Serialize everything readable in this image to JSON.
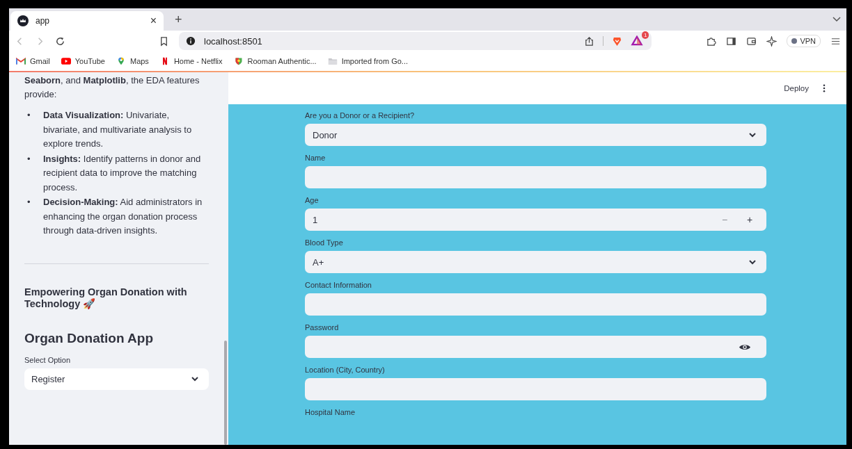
{
  "browser": {
    "tab": {
      "title": "app",
      "close": "×"
    },
    "new_tab": "+",
    "url": "localhost:8501",
    "badge": "1",
    "vpn": "VPN",
    "bookmarks": [
      {
        "label": "Gmail",
        "kind": "mail"
      },
      {
        "label": "YouTube",
        "kind": "video"
      },
      {
        "label": "Maps",
        "kind": "pin"
      },
      {
        "label": "Home - Netflix",
        "kind": "letter"
      },
      {
        "label": "Rooman Authentic...",
        "kind": "shield"
      },
      {
        "label": "Imported from Go...",
        "kind": "folder"
      }
    ]
  },
  "sidebar": {
    "intro": "**Seaborn**, and **Matplotlib**, the EDA features provide:",
    "bullets": [
      {
        "marker": "•",
        "text": "**Data Visualization:** Univariate, bivariate, and multivariate analysis to explore trends."
      },
      {
        "marker": "•",
        "text": "**Insights:** Identify patterns in donor and recipient data to improve the matching process."
      },
      {
        "marker": "•",
        "text": "**Decision-Making:** Aid administrators in enhancing the organ donation process through data-driven insights."
      }
    ],
    "tagline": "Empowering Organ Donation with Technology 🚀",
    "app_title": "Organ Donation App",
    "select_label": "Select Option",
    "select_value": "Register"
  },
  "header": {
    "deploy": "Deploy"
  },
  "form": [
    {
      "label": "Are you a Donor or a Recipient?",
      "kind": "select",
      "value": "Donor"
    },
    {
      "label": "Name",
      "kind": "text"
    },
    {
      "label": "Age",
      "kind": "number",
      "value": "1",
      "minus": "−",
      "plus": "+"
    },
    {
      "label": "Blood Type",
      "kind": "select",
      "value": "A+"
    },
    {
      "label": "Contact Information",
      "kind": "text"
    },
    {
      "label": "Password",
      "kind": "password"
    },
    {
      "label": "Location (City, Country)",
      "kind": "text"
    },
    {
      "label": "Hospital Name",
      "kind": "label"
    }
  ]
}
